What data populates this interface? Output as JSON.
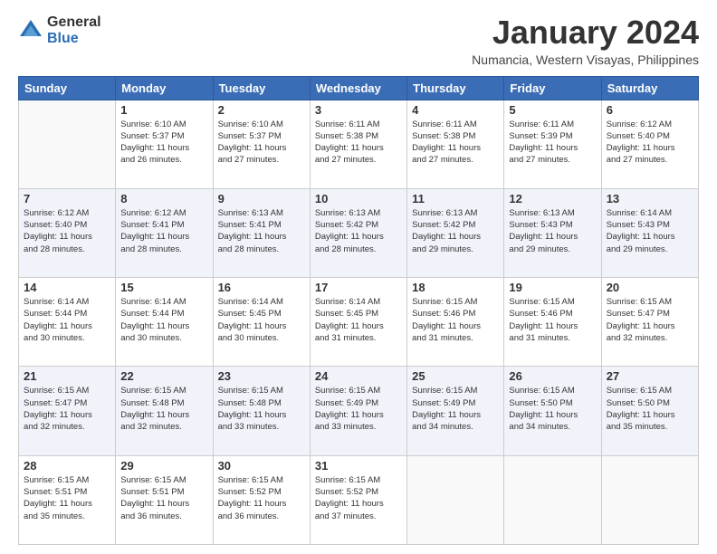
{
  "header": {
    "logo_general": "General",
    "logo_blue": "Blue",
    "month_title": "January 2024",
    "location": "Numancia, Western Visayas, Philippines"
  },
  "days_of_week": [
    "Sunday",
    "Monday",
    "Tuesday",
    "Wednesday",
    "Thursday",
    "Friday",
    "Saturday"
  ],
  "weeks": [
    [
      {
        "day": "",
        "info": ""
      },
      {
        "day": "1",
        "info": "Sunrise: 6:10 AM\nSunset: 5:37 PM\nDaylight: 11 hours\nand 26 minutes."
      },
      {
        "day": "2",
        "info": "Sunrise: 6:10 AM\nSunset: 5:37 PM\nDaylight: 11 hours\nand 27 minutes."
      },
      {
        "day": "3",
        "info": "Sunrise: 6:11 AM\nSunset: 5:38 PM\nDaylight: 11 hours\nand 27 minutes."
      },
      {
        "day": "4",
        "info": "Sunrise: 6:11 AM\nSunset: 5:38 PM\nDaylight: 11 hours\nand 27 minutes."
      },
      {
        "day": "5",
        "info": "Sunrise: 6:11 AM\nSunset: 5:39 PM\nDaylight: 11 hours\nand 27 minutes."
      },
      {
        "day": "6",
        "info": "Sunrise: 6:12 AM\nSunset: 5:40 PM\nDaylight: 11 hours\nand 27 minutes."
      }
    ],
    [
      {
        "day": "7",
        "info": "Sunrise: 6:12 AM\nSunset: 5:40 PM\nDaylight: 11 hours\nand 28 minutes."
      },
      {
        "day": "8",
        "info": "Sunrise: 6:12 AM\nSunset: 5:41 PM\nDaylight: 11 hours\nand 28 minutes."
      },
      {
        "day": "9",
        "info": "Sunrise: 6:13 AM\nSunset: 5:41 PM\nDaylight: 11 hours\nand 28 minutes."
      },
      {
        "day": "10",
        "info": "Sunrise: 6:13 AM\nSunset: 5:42 PM\nDaylight: 11 hours\nand 28 minutes."
      },
      {
        "day": "11",
        "info": "Sunrise: 6:13 AM\nSunset: 5:42 PM\nDaylight: 11 hours\nand 29 minutes."
      },
      {
        "day": "12",
        "info": "Sunrise: 6:13 AM\nSunset: 5:43 PM\nDaylight: 11 hours\nand 29 minutes."
      },
      {
        "day": "13",
        "info": "Sunrise: 6:14 AM\nSunset: 5:43 PM\nDaylight: 11 hours\nand 29 minutes."
      }
    ],
    [
      {
        "day": "14",
        "info": "Sunrise: 6:14 AM\nSunset: 5:44 PM\nDaylight: 11 hours\nand 30 minutes."
      },
      {
        "day": "15",
        "info": "Sunrise: 6:14 AM\nSunset: 5:44 PM\nDaylight: 11 hours\nand 30 minutes."
      },
      {
        "day": "16",
        "info": "Sunrise: 6:14 AM\nSunset: 5:45 PM\nDaylight: 11 hours\nand 30 minutes."
      },
      {
        "day": "17",
        "info": "Sunrise: 6:14 AM\nSunset: 5:45 PM\nDaylight: 11 hours\nand 31 minutes."
      },
      {
        "day": "18",
        "info": "Sunrise: 6:15 AM\nSunset: 5:46 PM\nDaylight: 11 hours\nand 31 minutes."
      },
      {
        "day": "19",
        "info": "Sunrise: 6:15 AM\nSunset: 5:46 PM\nDaylight: 11 hours\nand 31 minutes."
      },
      {
        "day": "20",
        "info": "Sunrise: 6:15 AM\nSunset: 5:47 PM\nDaylight: 11 hours\nand 32 minutes."
      }
    ],
    [
      {
        "day": "21",
        "info": "Sunrise: 6:15 AM\nSunset: 5:47 PM\nDaylight: 11 hours\nand 32 minutes."
      },
      {
        "day": "22",
        "info": "Sunrise: 6:15 AM\nSunset: 5:48 PM\nDaylight: 11 hours\nand 32 minutes."
      },
      {
        "day": "23",
        "info": "Sunrise: 6:15 AM\nSunset: 5:48 PM\nDaylight: 11 hours\nand 33 minutes."
      },
      {
        "day": "24",
        "info": "Sunrise: 6:15 AM\nSunset: 5:49 PM\nDaylight: 11 hours\nand 33 minutes."
      },
      {
        "day": "25",
        "info": "Sunrise: 6:15 AM\nSunset: 5:49 PM\nDaylight: 11 hours\nand 34 minutes."
      },
      {
        "day": "26",
        "info": "Sunrise: 6:15 AM\nSunset: 5:50 PM\nDaylight: 11 hours\nand 34 minutes."
      },
      {
        "day": "27",
        "info": "Sunrise: 6:15 AM\nSunset: 5:50 PM\nDaylight: 11 hours\nand 35 minutes."
      }
    ],
    [
      {
        "day": "28",
        "info": "Sunrise: 6:15 AM\nSunset: 5:51 PM\nDaylight: 11 hours\nand 35 minutes."
      },
      {
        "day": "29",
        "info": "Sunrise: 6:15 AM\nSunset: 5:51 PM\nDaylight: 11 hours\nand 36 minutes."
      },
      {
        "day": "30",
        "info": "Sunrise: 6:15 AM\nSunset: 5:52 PM\nDaylight: 11 hours\nand 36 minutes."
      },
      {
        "day": "31",
        "info": "Sunrise: 6:15 AM\nSunset: 5:52 PM\nDaylight: 11 hours\nand 37 minutes."
      },
      {
        "day": "",
        "info": ""
      },
      {
        "day": "",
        "info": ""
      },
      {
        "day": "",
        "info": ""
      }
    ]
  ]
}
